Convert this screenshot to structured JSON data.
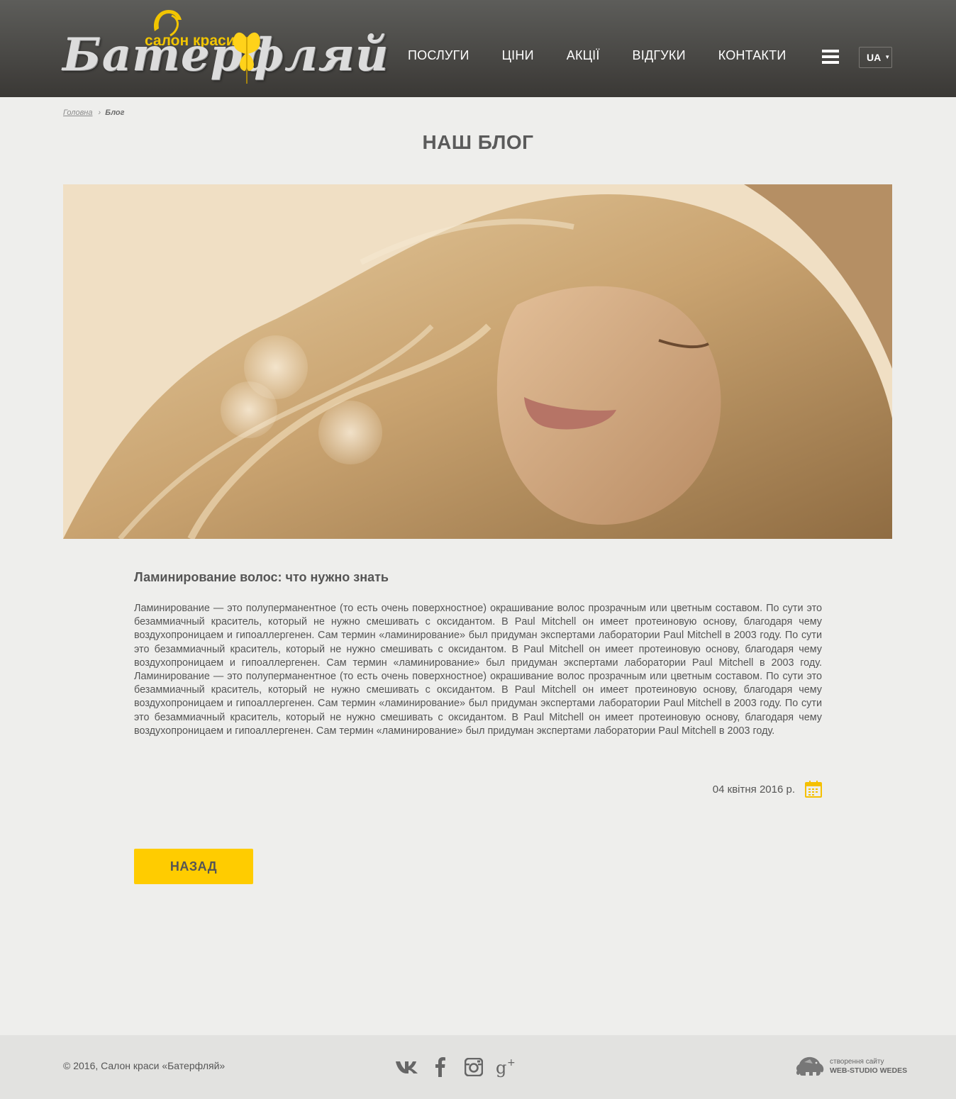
{
  "brand": {
    "name": "Батерфляй",
    "tagline": "салон краси",
    "accent": "#ffcc00"
  },
  "nav": {
    "items": [
      "ПОСЛУГИ",
      "ЦІНИ",
      "АКЦІЇ",
      "ВІДГУКИ",
      "КОНТАКТИ"
    ],
    "menu_icon": "hamburger-icon",
    "language": "UA"
  },
  "breadcrumb": {
    "home": "Головна",
    "separator": "›",
    "current": "Блог"
  },
  "page_title": "НАШ БЛОГ",
  "hero": {
    "image": "blonde-woman-photo"
  },
  "article": {
    "title": "Ламинирование волос: что нужно знать",
    "body": "Ламинирование — это полуперманентное (то есть очень поверхностное) окрашивание волос прозрачным или цветным составом. По сути это безаммиачный краситель, который не нужно смешивать с оксидантом. В Paul Mitchell он имеет протеиновую основу, благодаря чему воздухопроницаем и гипоаллергенен. Сам термин «ламинирование» был придуман экспертами лаборатории Paul Mitchell в 2003 году. По сути это безаммиачный краситель, который не нужно смешивать с оксидантом. В Paul Mitchell он имеет протеиновую основу, благодаря чему воздухопроницаем и гипоаллергенен. Сам термин «ламинирование» был придуман экспертами лаборатории Paul Mitchell в 2003 году. Ламинирование — это полуперманентное (то есть очень поверхностное) окрашивание волос прозрачным или цветным составом. По сути это безаммиачный краситель, который не нужно смешивать с оксидантом. В Paul Mitchell он имеет протеиновую основу, благодаря чему воздухопроницаем и гипоаллергенен. Сам термин «ламинирование» был придуман экспертами лаборатории Paul Mitchell в 2003 году. По сути это безаммиачный краситель, который не нужно смешивать с оксидантом. В Paul Mitchell он имеет протеиновую основу, благодаря чему воздухопроницаем и гипоаллергенен. Сам термин «ламинирование» был придуман экспертами лаборатории Paul Mitchell в 2003 году.",
    "date": "04 квітня 2016 р.",
    "date_icon": "calendar-icon",
    "back_label": "НАЗАД"
  },
  "footer": {
    "copyright": "© 2016, Салон краси «Батерфляй»",
    "socials": [
      "vk-icon",
      "facebook-icon",
      "instagram-icon",
      "google-plus-icon"
    ],
    "dev_line1": "створення сайту",
    "dev_line2": "WEB-STUDIO WEDES"
  }
}
